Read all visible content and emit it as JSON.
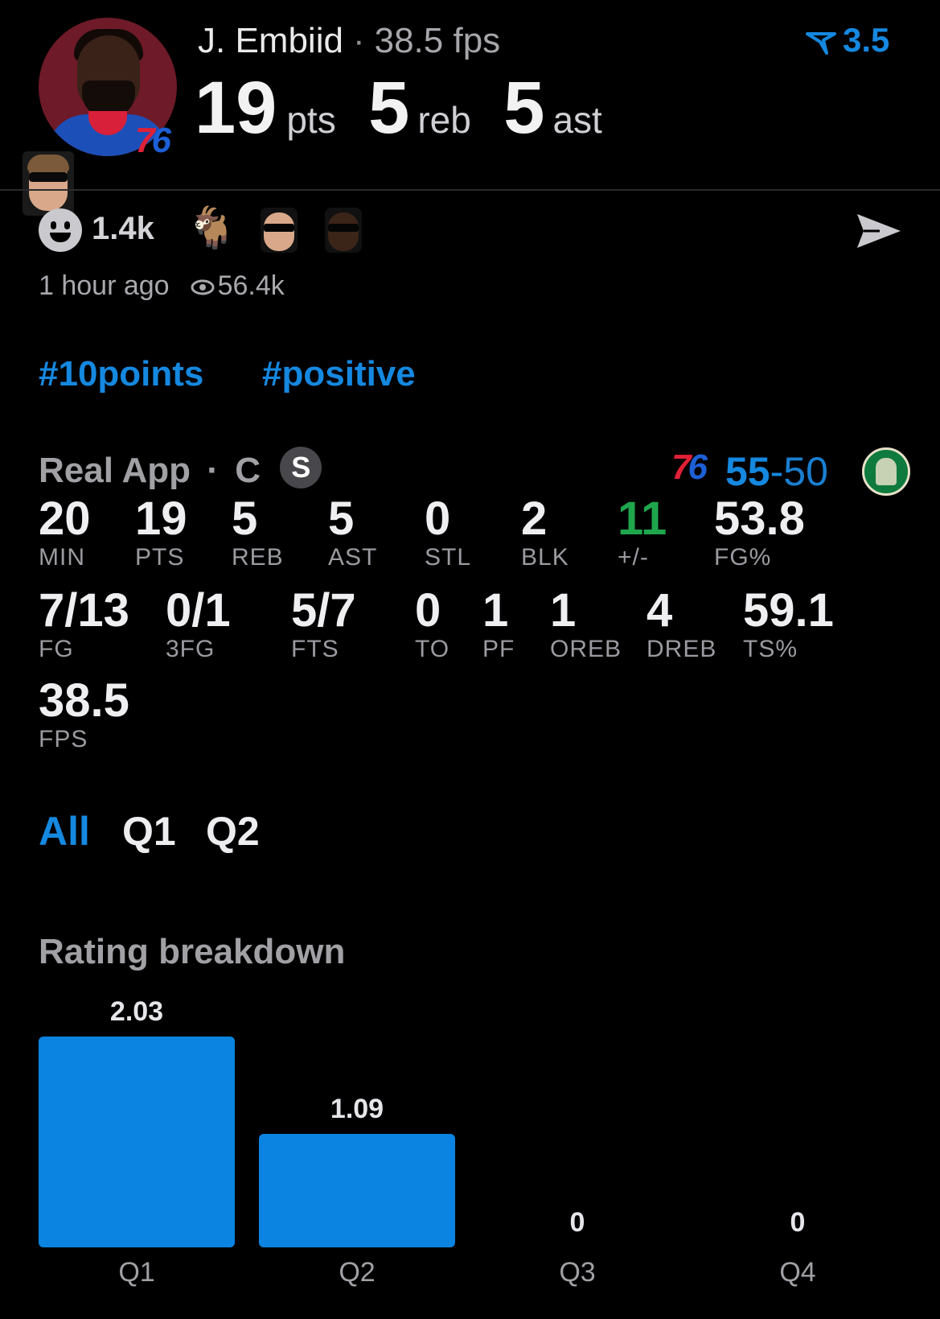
{
  "player": {
    "name": "J. Embiid",
    "separator": "·",
    "fps_text": "38.5 fps",
    "pts": "19",
    "pts_unit": "pts",
    "reb": "5",
    "reb_unit": "reb",
    "ast": "5",
    "ast_unit": "ast",
    "team_badge": {
      "part1": "7",
      "part2": "6"
    },
    "boost_value": "3.5",
    "accent": "#1588e0"
  },
  "reactions": {
    "count": "1.4k",
    "goat_emoji": "🐐",
    "time": "1 hour ago",
    "views": "56.4k",
    "icons": [
      "smile-icon",
      "goat-icon",
      "send-icon",
      "eye-icon"
    ]
  },
  "tags": [
    "#10points",
    "#positive"
  ],
  "game": {
    "source": "Real App",
    "dot": "·",
    "position": "C",
    "badge": "S",
    "home_logo": {
      "part1": "7",
      "part2": "6"
    },
    "home_score": "55",
    "dash": "-",
    "away_score": "50"
  },
  "stats_row1": [
    {
      "value": "20",
      "label": "MIN"
    },
    {
      "value": "19",
      "label": "PTS"
    },
    {
      "value": "5",
      "label": "REB"
    },
    {
      "value": "5",
      "label": "AST"
    },
    {
      "value": "0",
      "label": "STL"
    },
    {
      "value": "2",
      "label": "BLK"
    },
    {
      "value": "11",
      "label": "+/-",
      "color": "#1fa64d"
    },
    {
      "value": "53.8",
      "label": "FG%"
    }
  ],
  "stats_row2": [
    {
      "value": "7/13",
      "label": "FG"
    },
    {
      "value": "0/1",
      "label": "3FG"
    },
    {
      "value": "5/7",
      "label": "FTS"
    },
    {
      "value": "0",
      "label": "TO"
    },
    {
      "value": "1",
      "label": "PF"
    },
    {
      "value": "1",
      "label": "OREB"
    },
    {
      "value": "4",
      "label": "DREB"
    },
    {
      "value": "59.1",
      "label": "TS%"
    }
  ],
  "stats_row3": [
    {
      "value": "38.5",
      "label": "FPS"
    }
  ],
  "period_tabs": [
    {
      "label": "All",
      "active": true
    },
    {
      "label": "Q1",
      "active": false
    },
    {
      "label": "Q2",
      "active": false
    }
  ],
  "rating": {
    "title": "Rating breakdown"
  },
  "chart_data": {
    "type": "bar",
    "title": "Rating breakdown",
    "categories": [
      "Q1",
      "Q2",
      "Q3",
      "Q4"
    ],
    "values": [
      2.03,
      1.09,
      0,
      0
    ],
    "value_labels": [
      "2.03",
      "1.09",
      "0",
      "0"
    ],
    "xlabel": "",
    "ylabel": "",
    "ylim": [
      0,
      2.03
    ],
    "grid": false,
    "bar_color": "#0a84e0"
  }
}
